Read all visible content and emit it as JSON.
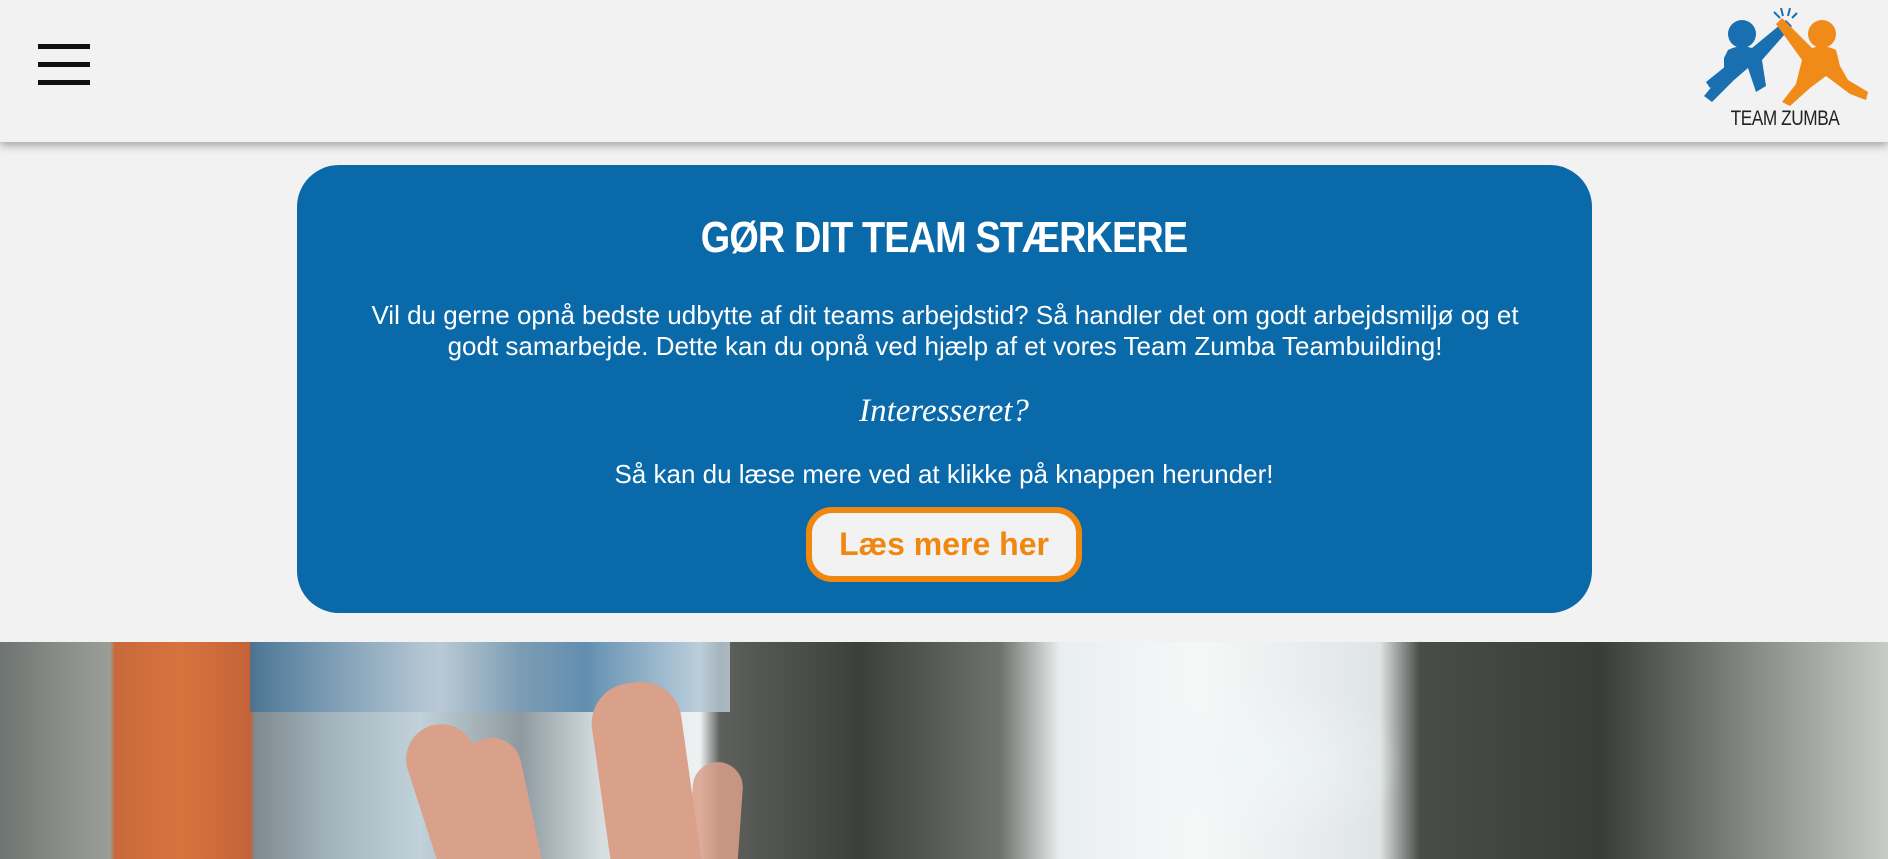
{
  "header": {
    "menu_icon": "hamburger-menu-icon",
    "logo": {
      "text": "TEAM ZUMBA",
      "icon": "high-five-people-logo",
      "colors": {
        "blue": "#1a6fb0",
        "orange": "#f08a18"
      }
    }
  },
  "promo": {
    "title": "GØR DIT TEAM STÆRKERE",
    "body": "Vil du gerne opnå bedste udbytte af dit teams arbejdstid? Så handler det om godt arbejdsmiljø og et godt samarbejde. Dette kan du opnå ved hjælp af et vores Team Zumba Teambuilding!",
    "question": "Interesseret?",
    "cta_text": "Så kan du læse mere ved at klikke på knappen herunder!",
    "button_label": "Læs mere her",
    "colors": {
      "card": "#0a69a8",
      "button_border": "#ef8710",
      "background": "#f2f2f2"
    }
  },
  "hero_image": {
    "subject": "high-five-hands-photo"
  }
}
